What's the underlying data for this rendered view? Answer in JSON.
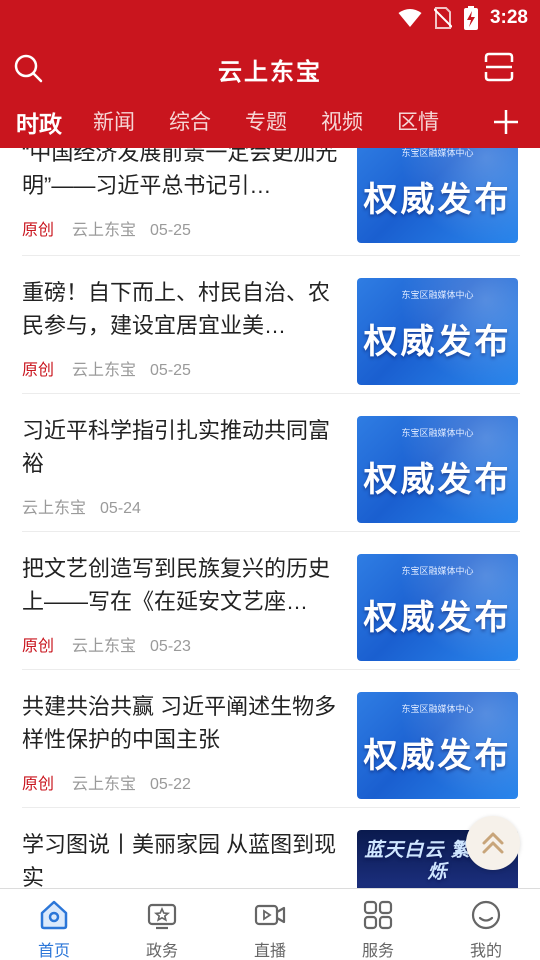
{
  "status": {
    "time": "3:28"
  },
  "header": {
    "title": "云上东宝"
  },
  "tabs": [
    {
      "label": "时政",
      "active": true
    },
    {
      "label": "新闻"
    },
    {
      "label": "综合"
    },
    {
      "label": "专题"
    },
    {
      "label": "视频"
    },
    {
      "label": "区情"
    }
  ],
  "feed": [
    {
      "title": "“中国经济发展前景一定会更加光明”——习近平总书记引…",
      "original": "原创",
      "source": "云上东宝",
      "date": "05-25",
      "thumb_text": "权威发布",
      "thumb_org": "东宝区融媒体中心"
    },
    {
      "title": "重磅！自下而上、村民自治、农民参与，建设宜居宜业美…",
      "original": "原创",
      "source": "云上东宝",
      "date": "05-25",
      "thumb_text": "权威发布",
      "thumb_org": "东宝区融媒体中心"
    },
    {
      "title": "习近平科学指引扎实推动共同富裕",
      "original": "",
      "source": "云上东宝",
      "date": "05-24",
      "thumb_text": "权威发布",
      "thumb_org": "东宝区融媒体中心"
    },
    {
      "title": "把文艺创造写到民族复兴的历史上——写在《在延安文艺座…",
      "original": "原创",
      "source": "云上东宝",
      "date": "05-23",
      "thumb_text": "权威发布",
      "thumb_org": "东宝区融媒体中心"
    },
    {
      "title": "共建共治共赢 习近平阐述生物多样性保护的中国主张",
      "original": "原创",
      "source": "云上东宝",
      "date": "05-22",
      "thumb_text": "权威发布",
      "thumb_org": "东宝区融媒体中心"
    },
    {
      "title": "学习图说丨美丽家园 从蓝图到现实",
      "thumb_text": "蓝天白云 繁星闪烁"
    }
  ],
  "bottom_nav": [
    {
      "label": "首页",
      "icon": "home-icon",
      "active": true
    },
    {
      "label": "政务",
      "icon": "tv-icon"
    },
    {
      "label": "直播",
      "icon": "video-icon"
    },
    {
      "label": "服务",
      "icon": "grid-icon"
    },
    {
      "label": "我的",
      "icon": "user-icon"
    }
  ],
  "colors": {
    "brand": "#c9151e",
    "nav_active": "#2b76d8"
  }
}
